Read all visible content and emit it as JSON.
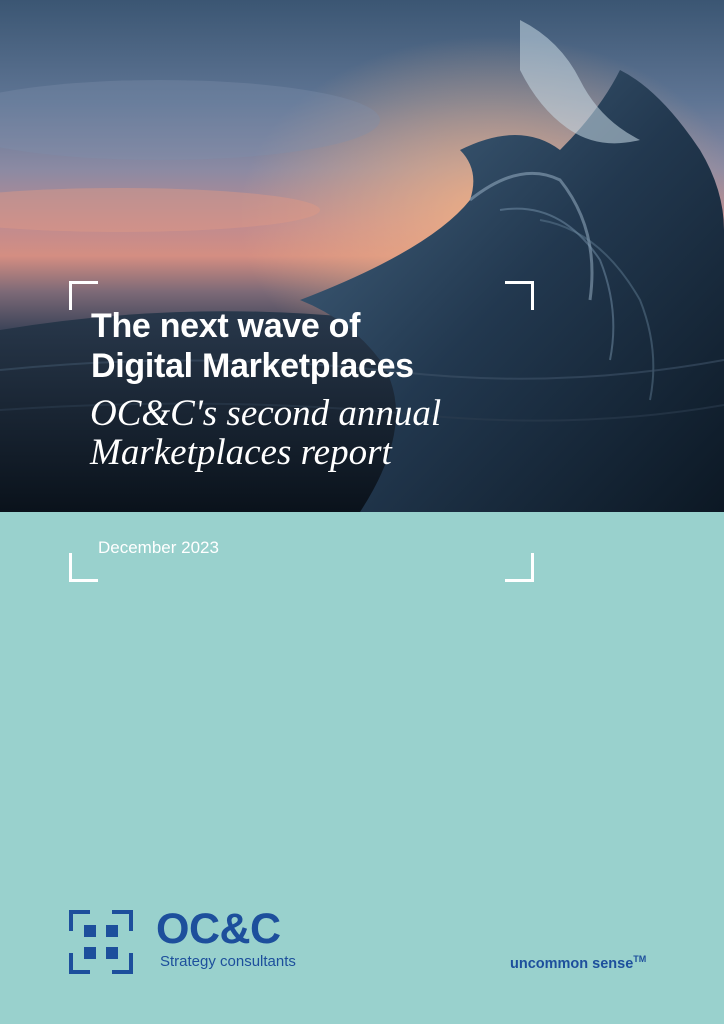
{
  "cover": {
    "title_lines": [
      "The next wave of",
      "Digital Marketplaces"
    ],
    "subtitle_lines": [
      "OC&C's second annual",
      "Marketplaces report"
    ],
    "date": "December 2023"
  },
  "brand": {
    "name": "OC&C",
    "descriptor": "Strategy consultants",
    "tagline": "uncommon sense",
    "tagline_mark": "TM",
    "color": "#1d4f9c"
  },
  "colors": {
    "panel": "#99d1cd",
    "text_on_image": "#ffffff"
  },
  "icons": {
    "logo": "oc-c-square-grid-logo-icon"
  }
}
